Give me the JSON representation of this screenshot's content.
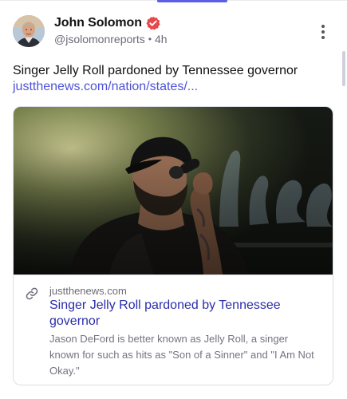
{
  "post": {
    "author": {
      "display_name": "John Solomon",
      "handle": "@jsolomonreports",
      "separator": "•",
      "time_ago": "4h",
      "verified_icon": "verified-badge-icon",
      "verified_color": "#e5484d"
    },
    "text": "Singer Jelly Roll pardoned by Tennessee governor",
    "link_text": "justthenews.com/nation/states/...",
    "link_color": "#4f52d6",
    "more_icon": "more-vertical-icon"
  },
  "link_card": {
    "image_alt": "Jelly Roll singing into a microphone on stage",
    "link_icon": "link-icon",
    "domain": "justthenews.com",
    "title": "Singer Jelly Roll pardoned by Tennessee governor",
    "description": "Jason DeFord is better known as Jelly Roll, a singer known for such as hits as \"Son of a Sinner\" and \"I Am Not Okay.\"",
    "title_color": "#2b2dab"
  },
  "colors": {
    "accent": "#5b5fe6",
    "text_primary": "#111111",
    "text_secondary": "#6b6b78"
  }
}
